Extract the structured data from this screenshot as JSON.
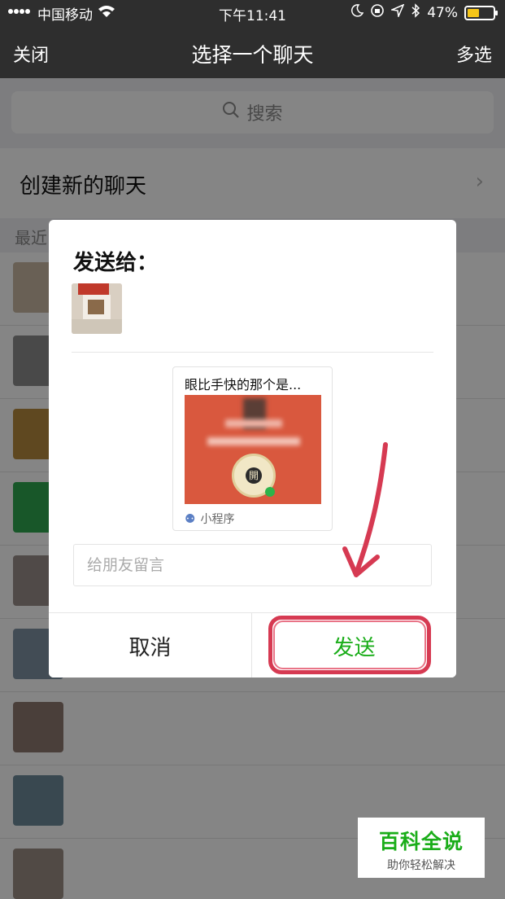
{
  "status_bar": {
    "carrier": "中国移动",
    "time": "下午11:41",
    "battery": "47%",
    "battery_level": 0.47
  },
  "nav": {
    "left": "关闭",
    "title": "选择一个聊天",
    "right": "多选"
  },
  "search": {
    "placeholder": "搜索"
  },
  "new_chat": {
    "label": "创建新的聊天"
  },
  "recent_label": "最近",
  "chat_rows": [
    {
      "name": "",
      "avatar_color": "#c9b9a3"
    },
    {
      "name": "",
      "avatar_color": "#8d8d8d"
    },
    {
      "name": "",
      "avatar_color": "#b78a3f"
    },
    {
      "name": "",
      "avatar_color": "#2fa84f"
    },
    {
      "name": "",
      "avatar_color": "#9a8f8a"
    },
    {
      "name": "",
      "avatar_color": "#7f92a3"
    },
    {
      "name": "",
      "avatar_color": "#8f7a70"
    },
    {
      "name": "",
      "avatar_color": "#6e8b9a"
    },
    {
      "name": "",
      "avatar_color": "#9b8f85"
    }
  ],
  "dialog": {
    "title": "发送给：",
    "recipient_name": "",
    "card": {
      "title": "眼比手快的那个是...",
      "footer": "小程序",
      "qr_glyph": "開"
    },
    "message_placeholder": "给朋友留言",
    "cancel": "取消",
    "send": "发送"
  },
  "watermark": {
    "title": "百科全说",
    "subtitle": "助你轻松解决"
  },
  "colors": {
    "nav_bg": "#2e2e2e",
    "send_green": "#1aad19",
    "highlight_red": "#d63a52",
    "card_red": "#d9583e"
  }
}
